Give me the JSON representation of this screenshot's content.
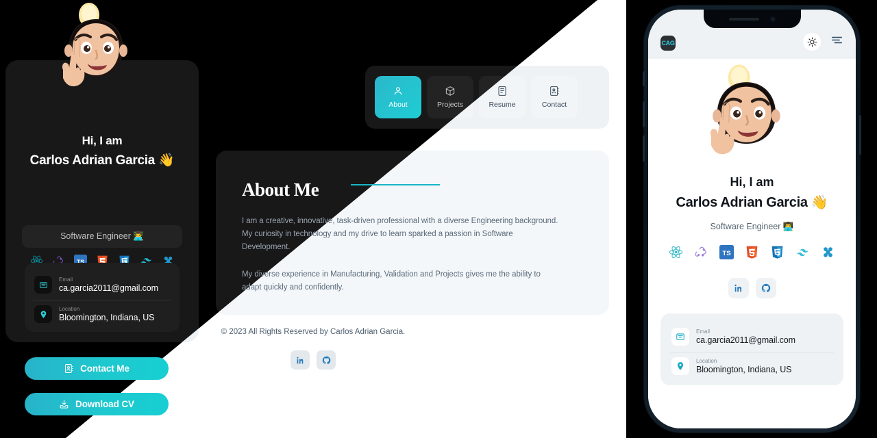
{
  "theme": {
    "accent": "#1ec8cf",
    "accent_dark": "#27b3c9",
    "dark_bg": "#000000",
    "dark_card": "#181818",
    "light_bg": "#ffffff",
    "light_card": "#eef2f5"
  },
  "profile": {
    "greeting_line1": "Hi, I am",
    "greeting_line2": "Carlos Adrian Garcia 👋",
    "role": "Software Engineer 👨‍💻",
    "avatar_alt": "memoji-avatar-with-lightbulb",
    "tech_stack": [
      {
        "name": "react-icon",
        "label": "React"
      },
      {
        "name": "redux-icon",
        "label": "Redux"
      },
      {
        "name": "typescript-icon",
        "label": "TypeScript"
      },
      {
        "name": "html5-icon",
        "label": "HTML5"
      },
      {
        "name": "css3-icon",
        "label": "CSS3"
      },
      {
        "name": "tailwindcss-icon",
        "label": "Tailwind CSS"
      },
      {
        "name": "framer-motion-icon",
        "label": "Framer Motion"
      }
    ],
    "socials": [
      {
        "name": "linkedin-icon",
        "label": "LinkedIn"
      },
      {
        "name": "github-icon",
        "label": "GitHub"
      }
    ],
    "info": [
      {
        "icon": "email-icon",
        "label": "Email",
        "value": "ca.garcia2011@gmail.com"
      },
      {
        "icon": "location-pin-icon",
        "label": "Location",
        "value": "Bloomington, Indiana, US"
      }
    ],
    "buttons": [
      {
        "name": "contact-me-button",
        "label": "Contact Me",
        "icon": "contact-book-icon"
      },
      {
        "name": "download-cv-button",
        "label": "Download CV",
        "icon": "download-tray-icon"
      }
    ]
  },
  "nav": {
    "tabs": [
      {
        "label": "About",
        "icon": "user-icon",
        "active": true
      },
      {
        "label": "Projects",
        "icon": "box-icon",
        "active": false
      },
      {
        "label": "Resume",
        "icon": "document-icon",
        "active": false
      },
      {
        "label": "Contact",
        "icon": "contact-book-icon",
        "active": false
      }
    ]
  },
  "about": {
    "title": "About Me",
    "paragraph1": "I am a creative, innovative, task-driven professional with a diverse Engineering background. My curiosity in technology and my drive to learn sparked a passion in Software Development.",
    "paragraph2": "My diverse experience in Manufacturing, Validation and Projects gives me the ability to adapt quickly and confidently."
  },
  "footer": {
    "copyright": "© 2023 All Rights Reserved by Carlos Adrian Garcia."
  },
  "phone": {
    "logo": "CAG",
    "theme_toggle_icon": "sun-icon",
    "menu_icon": "hamburger-menu-icon"
  }
}
